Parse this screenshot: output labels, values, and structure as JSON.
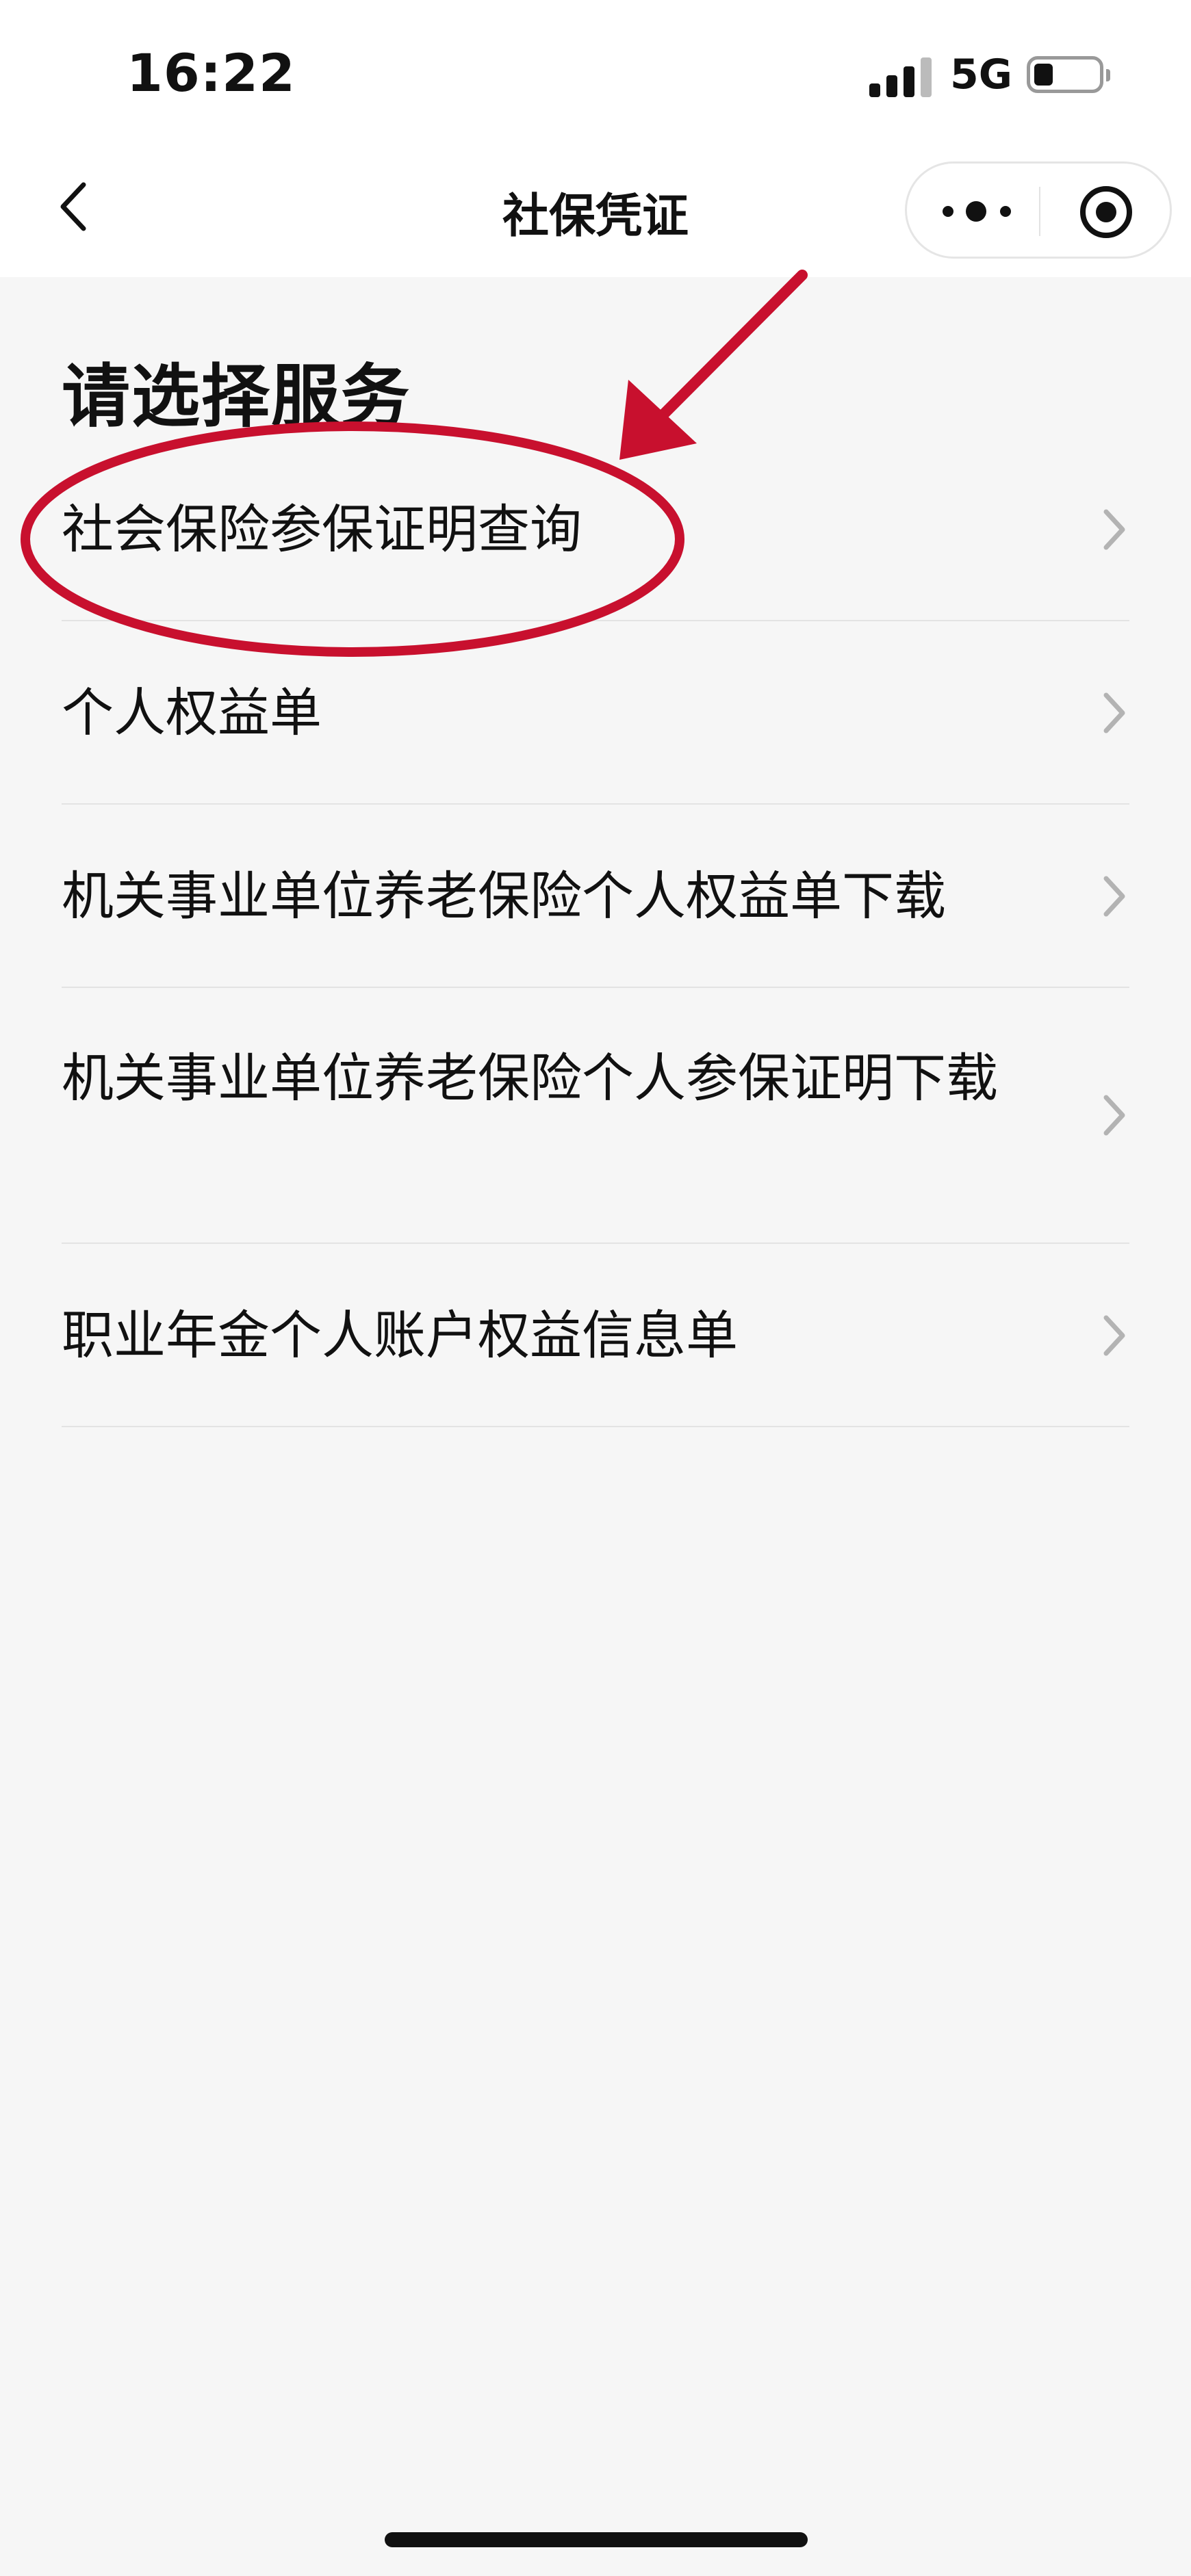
{
  "status_bar": {
    "time": "16:22",
    "network": "5G",
    "battery_level": 0.3
  },
  "nav": {
    "title": "社保凭证",
    "back_icon": "chevron-left-icon",
    "more_icon": "more-dots-icon",
    "close_icon": "target-icon"
  },
  "section_title": "请选择服务",
  "services": [
    {
      "label": "社会保险参保证明查询"
    },
    {
      "label": "个人权益单"
    },
    {
      "label": "机关事业单位养老保险个人权益单下载"
    },
    {
      "label": "机关事业单位养老保险个人参保证明下载"
    },
    {
      "label": "职业年金个人账户权益信息单"
    }
  ],
  "annotation": {
    "color": "#c8102e",
    "shapes": [
      "arrow",
      "ellipse"
    ]
  }
}
